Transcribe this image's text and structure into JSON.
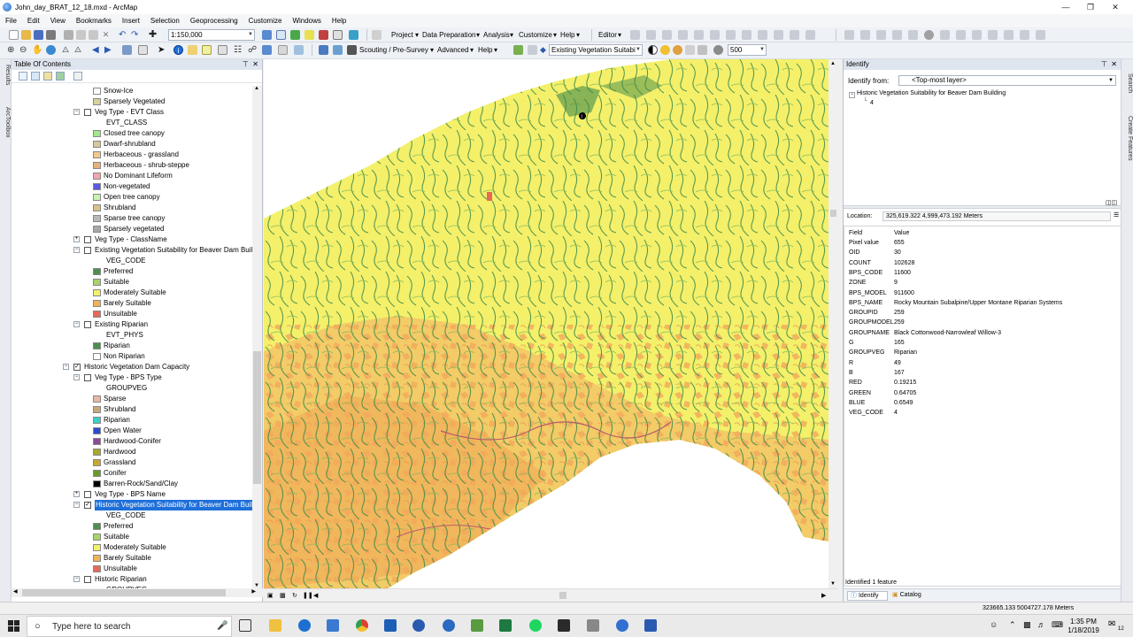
{
  "window": {
    "title": "John_day_BRAT_12_18.mxd - ArcMap"
  },
  "menu": [
    "File",
    "Edit",
    "View",
    "Bookmarks",
    "Insert",
    "Selection",
    "Geoprocessing",
    "Customize",
    "Windows",
    "Help"
  ],
  "toolbar1": {
    "scale": "1:150,000",
    "project": "Project",
    "data_prep": "Data Preparation",
    "analysis": "Analysis",
    "customize": "Customize",
    "help": "Help",
    "editor": "Editor"
  },
  "toolbar2": {
    "scouting": "Scouting / Pre-Survey",
    "advanced": "Advanced",
    "help": "Help",
    "layer_combo": "Existing Vegetation Suitabi",
    "value_combo": "500"
  },
  "side_tabs_left": [
    "Results",
    "ArcToolbox"
  ],
  "side_tabs_right": [
    "Search",
    "Create Features"
  ],
  "toc": {
    "title": "Table Of Contents",
    "rows": [
      {
        "type": "class",
        "label": "Snow-Ice",
        "color": "#ffffff"
      },
      {
        "type": "class",
        "label": "Sparsely Vegetated",
        "color": "#d6d29e"
      },
      {
        "type": "layer",
        "label": "Veg Type - EVT Class",
        "checked": false
      },
      {
        "type": "field",
        "label": "EVT_CLASS"
      },
      {
        "type": "class",
        "label": "Closed tree canopy",
        "color": "#a3e88a"
      },
      {
        "type": "class",
        "label": "Dwarf-shrubland",
        "color": "#d6c99a"
      },
      {
        "type": "class",
        "label": "Herbaceous - grassland",
        "color": "#f2c98c"
      },
      {
        "type": "class",
        "label": "Herbaceous - shrub-steppe",
        "color": "#e8b07c"
      },
      {
        "type": "class",
        "label": "No Dominant Lifeform",
        "color": "#f2a6b0"
      },
      {
        "type": "class",
        "label": "Non-vegetated",
        "color": "#5a5ae0"
      },
      {
        "type": "class",
        "label": "Open tree canopy",
        "color": "#c8f2b0"
      },
      {
        "type": "class",
        "label": "Shrubland",
        "color": "#d9c28a"
      },
      {
        "type": "class",
        "label": "Sparse tree canopy",
        "color": "#b8b8b8"
      },
      {
        "type": "class",
        "label": "Sparsely vegetated",
        "color": "#a8a8a8"
      },
      {
        "type": "layer-collapsed",
        "label": "Veg Type - ClassName",
        "checked": false
      },
      {
        "type": "layer",
        "label": "Existing Vegetation Suitability for Beaver Dam Buil",
        "checked": false
      },
      {
        "type": "field",
        "label": "VEG_CODE"
      },
      {
        "type": "class",
        "label": "Preferred",
        "color": "#4d8f4d"
      },
      {
        "type": "class",
        "label": "Suitable",
        "color": "#a8d36a"
      },
      {
        "type": "class",
        "label": "Moderately Suitable",
        "color": "#f2f26a"
      },
      {
        "type": "class",
        "label": "Barely Suitable",
        "color": "#f2b25a"
      },
      {
        "type": "class",
        "label": "Unsuitable",
        "color": "#e8685a"
      },
      {
        "type": "layer",
        "label": "Existing Riparian",
        "checked": false
      },
      {
        "type": "field",
        "label": "EVT_PHYS"
      },
      {
        "type": "class",
        "label": "Riparian",
        "color": "#4d8f4d"
      },
      {
        "type": "class",
        "label": "Non Riparian",
        "color": "#ffffff"
      },
      {
        "type": "group",
        "label": "Historic Vegetation Dam Capacity",
        "checked": true
      },
      {
        "type": "layer2",
        "label": "Veg Type - BPS Type",
        "checked": false
      },
      {
        "type": "field2",
        "label": "GROUPVEG"
      },
      {
        "type": "class2",
        "label": "Sparse",
        "color": "#e8b8a8"
      },
      {
        "type": "class2",
        "label": "Shrubland",
        "color": "#c8a878"
      },
      {
        "type": "class2",
        "label": "Riparian",
        "color": "#3ad0c8"
      },
      {
        "type": "class2",
        "label": "Open Water",
        "color": "#2a4ad0"
      },
      {
        "type": "class2",
        "label": "Hardwood-Conifer",
        "color": "#8a4a9a"
      },
      {
        "type": "class2",
        "label": "Hardwood",
        "color": "#a8a830"
      },
      {
        "type": "class2",
        "label": "Grassland",
        "color": "#c8a830"
      },
      {
        "type": "class2",
        "label": "Conifer",
        "color": "#6a9a2a"
      },
      {
        "type": "class2",
        "label": "Barren-Rock/Sand/Clay",
        "color": "#000000"
      },
      {
        "type": "layer2-collapsed",
        "label": "Veg Type - BPS Name",
        "checked": false
      },
      {
        "type": "layer2-selected",
        "label": "Historic Vegetation Suitability for Beaver Dam Buil",
        "checked": true
      },
      {
        "type": "field2",
        "label": "VEG_CODE"
      },
      {
        "type": "class2",
        "label": "Preferred",
        "color": "#4d8f4d"
      },
      {
        "type": "class2",
        "label": "Suitable",
        "color": "#a8d36a"
      },
      {
        "type": "class2",
        "label": "Moderately Suitable",
        "color": "#f2f26a"
      },
      {
        "type": "class2",
        "label": "Barely Suitable",
        "color": "#f2b25a"
      },
      {
        "type": "class2",
        "label": "Unsuitable",
        "color": "#e8685a"
      },
      {
        "type": "layer2",
        "label": "Historic Riparian",
        "checked": false
      },
      {
        "type": "field2",
        "label": "GROUPVEG"
      }
    ]
  },
  "identify": {
    "title": "Identify",
    "from_label": "Identify from:",
    "from_value": "<Top-most layer>",
    "tree_layer": "Historic Vegetation Suitability for Beaver Dam Building",
    "tree_value": "4",
    "location_label": "Location:",
    "location_value": "325,619.322  4,999,473.192 Meters",
    "col_field": "Field",
    "col_value": "Value",
    "fields": [
      {
        "f": "Pixel value",
        "v": "655"
      },
      {
        "f": "OID",
        "v": "30"
      },
      {
        "f": "COUNT",
        "v": "102628"
      },
      {
        "f": "BPS_CODE",
        "v": "11600"
      },
      {
        "f": "ZONE",
        "v": "9"
      },
      {
        "f": "BPS_MODEL",
        "v": "911600"
      },
      {
        "f": "BPS_NAME",
        "v": "Rocky Mountain Subalpine/Upper Montane Riparian Systems"
      },
      {
        "f": "GROUPID",
        "v": "259"
      },
      {
        "f": "GROUPMODEL",
        "v": "259"
      },
      {
        "f": "GROUPNAME",
        "v": "Black Cottonwood-Narrowleaf Willow-3"
      },
      {
        "f": "G",
        "v": "165"
      },
      {
        "f": "GROUPVEG",
        "v": "Riparian"
      },
      {
        "f": "R",
        "v": "49"
      },
      {
        "f": "B",
        "v": "167"
      },
      {
        "f": "RED",
        "v": "0.19215"
      },
      {
        "f": "GREEN",
        "v": "0.64705"
      },
      {
        "f": "BLUE",
        "v": "0.6549"
      },
      {
        "f": "VEG_CODE",
        "v": "4"
      }
    ],
    "footer": "Identified 1 feature",
    "tab_identify": "Identify",
    "tab_catalog": "Catalog"
  },
  "status": {
    "coords": "323665.133  5004727.178 Meters"
  },
  "taskbar": {
    "search_placeholder": "Type here to search",
    "time": "1:35 PM",
    "date": "1/18/2019",
    "notif_count": "12"
  },
  "colors": {
    "preferred": "#3f8a4a",
    "suitable": "#a8d36a",
    "moderately": "#f2f26a",
    "barely": "#f2b25a",
    "unsuitable": "#e8685a",
    "selection": "#1e6fd9"
  }
}
